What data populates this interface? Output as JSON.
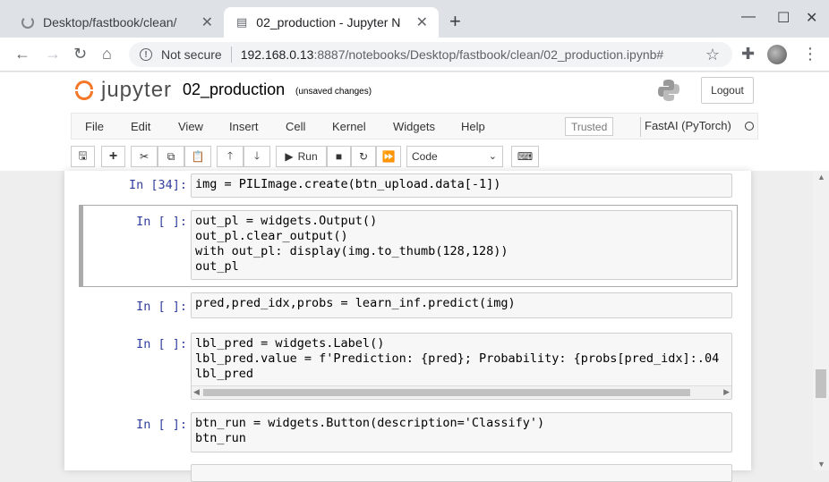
{
  "browser": {
    "tabs": [
      {
        "title": "Desktop/fastbook/clean/"
      },
      {
        "title": "02_production - Jupyter N"
      }
    ],
    "security_label": "Not secure",
    "url_host": "192.168.0.13",
    "url_path": ":8887/notebooks/Desktop/fastbook/clean/02_production.ipynb#"
  },
  "jupyter": {
    "logo_text": "jupyter",
    "notebook_title": "02_production",
    "save_status": "(unsaved changes)",
    "logout_label": "Logout",
    "menu": [
      "File",
      "Edit",
      "View",
      "Insert",
      "Cell",
      "Kernel",
      "Widgets",
      "Help"
    ],
    "trusted_label": "Trusted",
    "kernel_name": "FastAI (PyTorch)",
    "toolbar": {
      "run_label": "Run",
      "cell_type": "Code"
    }
  },
  "cells": [
    {
      "prompt": "In [34]:",
      "lines": [
        "img = PILImage.create(btn_upload.data[-1])"
      ]
    },
    {
      "prompt": "In [ ]:",
      "lines": [
        "out_pl = widgets.Output()",
        "out_pl.clear_output()",
        "with out_pl: display(img.to_thumb(128,128))",
        "out_pl"
      ]
    },
    {
      "prompt": "In [ ]:",
      "lines": [
        "pred,pred_idx,probs = learn_inf.predict(img)"
      ]
    },
    {
      "prompt": "In [ ]:",
      "lines": [
        "lbl_pred = widgets.Label()",
        "lbl_pred.value = f'Prediction: {pred}; Probability: {probs[pred_idx]:.04",
        "lbl_pred"
      ]
    },
    {
      "prompt": "In [ ]:",
      "lines": [
        "btn_run = widgets.Button(description='Classify')",
        "btn_run"
      ]
    }
  ]
}
